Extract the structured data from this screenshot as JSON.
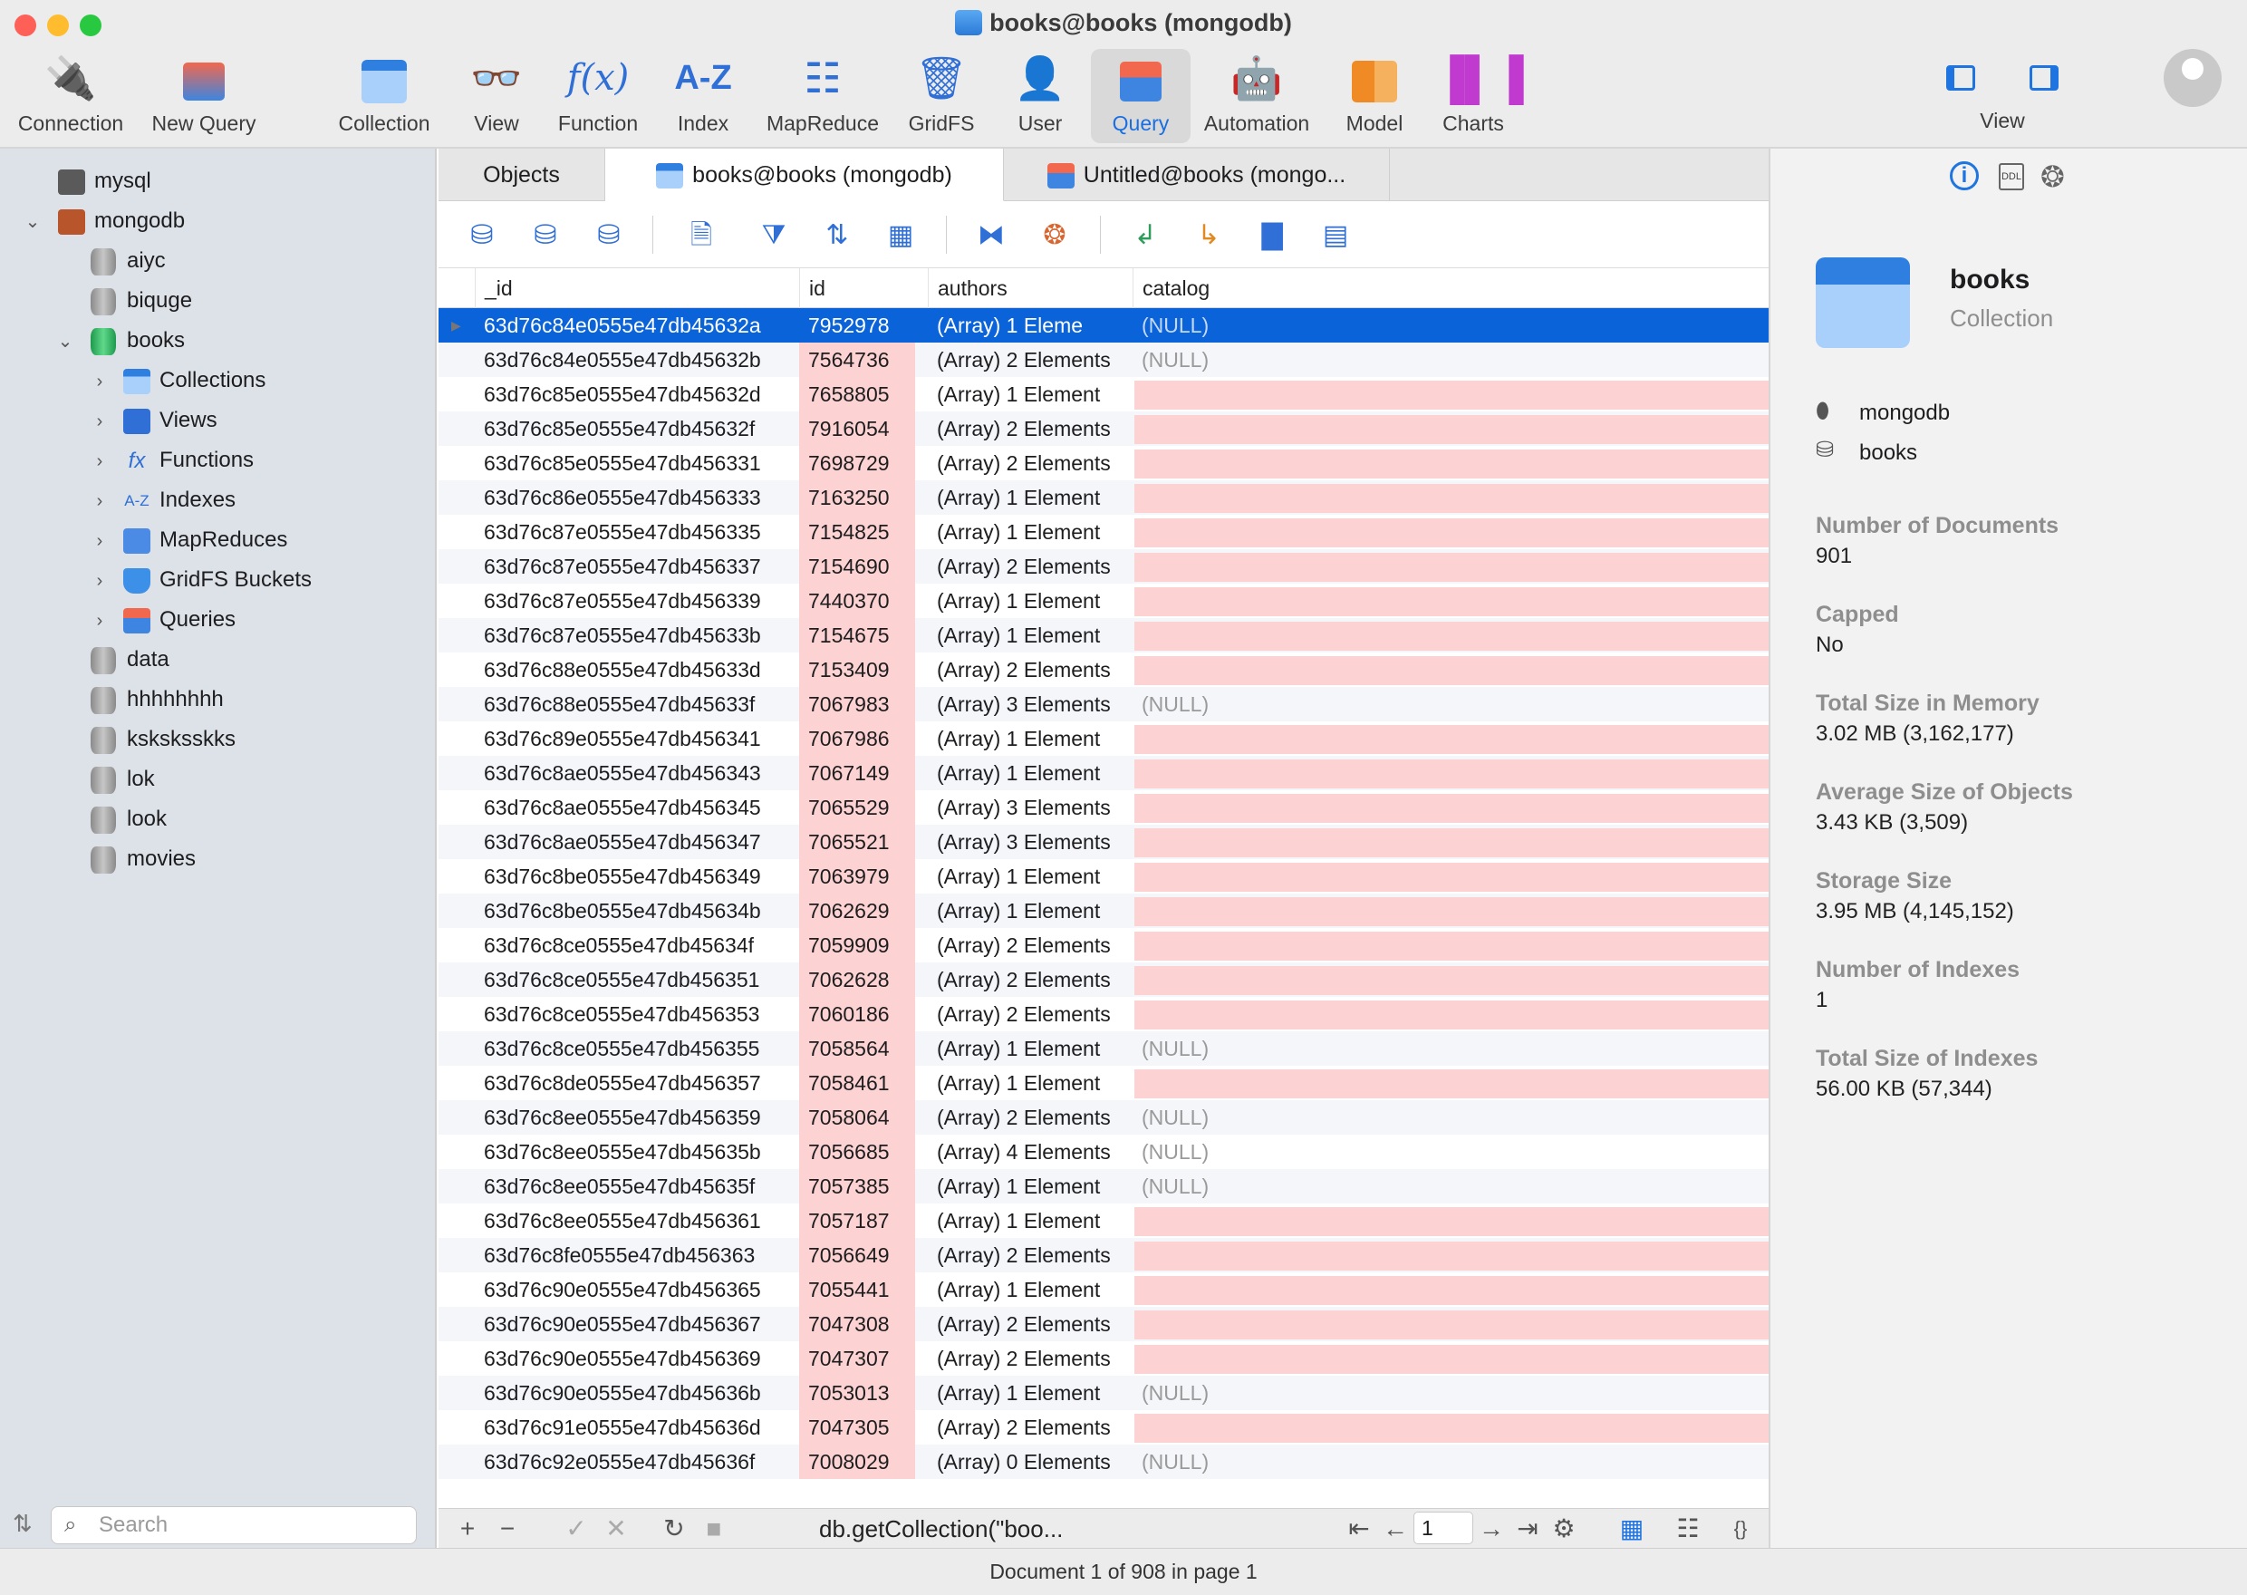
{
  "window": {
    "title": "books@books (mongodb)"
  },
  "toolbar": {
    "connection": "Connection",
    "new_query": "New Query",
    "collection": "Collection",
    "view": "View",
    "function": "Function",
    "index": "Index",
    "mapreduce": "MapReduce",
    "gridfs": "GridFS",
    "user": "User",
    "query": "Query",
    "automation": "Automation",
    "model": "Model",
    "charts": "Charts",
    "view_group": "View"
  },
  "sidebar": {
    "search_placeholder": "Search",
    "items": [
      {
        "label": "mysql"
      },
      {
        "label": "mongodb"
      },
      {
        "label": "aiyc"
      },
      {
        "label": "biquge"
      },
      {
        "label": "books"
      },
      {
        "label": "Collections"
      },
      {
        "label": "Views"
      },
      {
        "label": "Functions"
      },
      {
        "label": "Indexes"
      },
      {
        "label": "MapReduces"
      },
      {
        "label": "GridFS Buckets"
      },
      {
        "label": "Queries"
      },
      {
        "label": "data"
      },
      {
        "label": "hhhhhhhh"
      },
      {
        "label": "ksksksskks"
      },
      {
        "label": "lok"
      },
      {
        "label": "look"
      },
      {
        "label": "movies"
      }
    ]
  },
  "tabs": [
    {
      "label": "Objects"
    },
    {
      "label": "books@books (mongodb)"
    },
    {
      "label": "Untitled@books (mongo..."
    }
  ],
  "table": {
    "columns": [
      "_id",
      "id",
      "authors",
      "catalog"
    ],
    "rows": [
      {
        "oid": "63d76c84e0555e47db45632a",
        "id": "7952978",
        "authors": "(Array) 1 Eleme",
        "catalog": "(NULL)"
      },
      {
        "oid": "63d76c84e0555e47db45632b",
        "id": "7564736",
        "authors": "(Array) 2 Elements",
        "catalog": "(NULL)"
      },
      {
        "oid": "63d76c85e0555e47db45632d",
        "id": "7658805",
        "authors": "(Array) 1 Element",
        "catalog": ""
      },
      {
        "oid": "63d76c85e0555e47db45632f",
        "id": "7916054",
        "authors": "(Array) 2 Elements",
        "catalog": ""
      },
      {
        "oid": "63d76c85e0555e47db456331",
        "id": "7698729",
        "authors": "(Array) 2 Elements",
        "catalog": ""
      },
      {
        "oid": "63d76c86e0555e47db456333",
        "id": "7163250",
        "authors": "(Array) 1 Element",
        "catalog": ""
      },
      {
        "oid": "63d76c87e0555e47db456335",
        "id": "7154825",
        "authors": "(Array) 1 Element",
        "catalog": ""
      },
      {
        "oid": "63d76c87e0555e47db456337",
        "id": "7154690",
        "authors": "(Array) 2 Elements",
        "catalog": ""
      },
      {
        "oid": "63d76c87e0555e47db456339",
        "id": "7440370",
        "authors": "(Array) 1 Element",
        "catalog": ""
      },
      {
        "oid": "63d76c87e0555e47db45633b",
        "id": "7154675",
        "authors": "(Array) 1 Element",
        "catalog": ""
      },
      {
        "oid": "63d76c88e0555e47db45633d",
        "id": "7153409",
        "authors": "(Array) 2 Elements",
        "catalog": ""
      },
      {
        "oid": "63d76c88e0555e47db45633f",
        "id": "7067983",
        "authors": "(Array) 3 Elements",
        "catalog": "(NULL)"
      },
      {
        "oid": "63d76c89e0555e47db456341",
        "id": "7067986",
        "authors": "(Array) 1 Element",
        "catalog": ""
      },
      {
        "oid": "63d76c8ae0555e47db456343",
        "id": "7067149",
        "authors": "(Array) 1 Element",
        "catalog": ""
      },
      {
        "oid": "63d76c8ae0555e47db456345",
        "id": "7065529",
        "authors": "(Array) 3 Elements",
        "catalog": ""
      },
      {
        "oid": "63d76c8ae0555e47db456347",
        "id": "7065521",
        "authors": "(Array) 3 Elements",
        "catalog": ""
      },
      {
        "oid": "63d76c8be0555e47db456349",
        "id": "7063979",
        "authors": "(Array) 1 Element",
        "catalog": ""
      },
      {
        "oid": "63d76c8be0555e47db45634b",
        "id": "7062629",
        "authors": "(Array) 1 Element",
        "catalog": ""
      },
      {
        "oid": "63d76c8ce0555e47db45634f",
        "id": "7059909",
        "authors": "(Array) 2 Elements",
        "catalog": ""
      },
      {
        "oid": "63d76c8ce0555e47db456351",
        "id": "7062628",
        "authors": "(Array) 2 Elements",
        "catalog": ""
      },
      {
        "oid": "63d76c8ce0555e47db456353",
        "id": "7060186",
        "authors": "(Array) 2 Elements",
        "catalog": ""
      },
      {
        "oid": "63d76c8ce0555e47db456355",
        "id": "7058564",
        "authors": "(Array) 1 Element",
        "catalog": "(NULL)"
      },
      {
        "oid": "63d76c8de0555e47db456357",
        "id": "7058461",
        "authors": "(Array) 1 Element",
        "catalog": ""
      },
      {
        "oid": "63d76c8ee0555e47db456359",
        "id": "7058064",
        "authors": "(Array) 2 Elements",
        "catalog": "(NULL)"
      },
      {
        "oid": "63d76c8ee0555e47db45635b",
        "id": "7056685",
        "authors": "(Array) 4 Elements",
        "catalog": "(NULL)"
      },
      {
        "oid": "63d76c8ee0555e47db45635f",
        "id": "7057385",
        "authors": "(Array) 1 Element",
        "catalog": "(NULL)"
      },
      {
        "oid": "63d76c8ee0555e47db456361",
        "id": "7057187",
        "authors": "(Array) 1 Element",
        "catalog": ""
      },
      {
        "oid": "63d76c8fe0555e47db456363",
        "id": "7056649",
        "authors": "(Array) 2 Elements",
        "catalog": ""
      },
      {
        "oid": "63d76c90e0555e47db456365",
        "id": "7055441",
        "authors": "(Array) 1 Element",
        "catalog": ""
      },
      {
        "oid": "63d76c90e0555e47db456367",
        "id": "7047308",
        "authors": "(Array) 2 Elements",
        "catalog": ""
      },
      {
        "oid": "63d76c90e0555e47db456369",
        "id": "7047307",
        "authors": "(Array) 2 Elements",
        "catalog": ""
      },
      {
        "oid": "63d76c90e0555e47db45636b",
        "id": "7053013",
        "authors": "(Array) 1 Element",
        "catalog": "(NULL)"
      },
      {
        "oid": "63d76c91e0555e47db45636d",
        "id": "7047305",
        "authors": "(Array) 2 Elements",
        "catalog": ""
      },
      {
        "oid": "63d76c92e0555e47db45636f",
        "id": "7008029",
        "authors": "(Array) 0 Elements",
        "catalog": "(NULL)"
      }
    ]
  },
  "footer": {
    "query_text": "db.getCollection(\"boo...",
    "page_value": "1"
  },
  "status": "Document 1 of 908 in page 1",
  "panel": {
    "name": "books",
    "type": "Collection",
    "connection": "mongodb",
    "database": "books",
    "props": [
      {
        "label": "Number of Documents",
        "value": "901"
      },
      {
        "label": "Capped",
        "value": "No"
      },
      {
        "label": "Total Size in Memory",
        "value": "3.02 MB (3,162,177)"
      },
      {
        "label": "Average Size of Objects",
        "value": "3.43 KB (3,509)"
      },
      {
        "label": "Storage Size",
        "value": "3.95 MB (4,145,152)"
      },
      {
        "label": "Number of Indexes",
        "value": "1"
      },
      {
        "label": "Total Size of Indexes",
        "value": "56.00 KB (57,344)"
      }
    ]
  },
  "colors": {
    "accent": "#0a63d8",
    "pink_cell": "#fdd2d2",
    "sidebar_bg": "#dde2e8"
  }
}
